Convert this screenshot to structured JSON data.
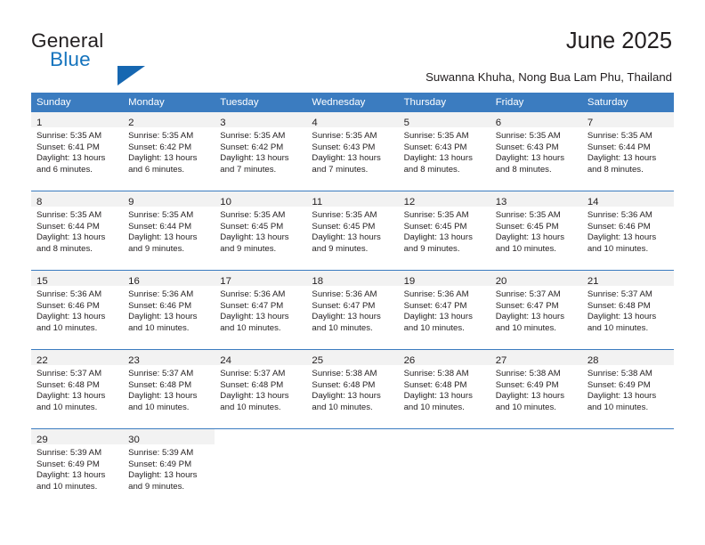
{
  "brand": {
    "name_part1": "General",
    "name_part2": "Blue",
    "accent_color": "#1473bd",
    "triangle_color": "#1667b1"
  },
  "header": {
    "title": "June 2025",
    "subtitle": "Suwanna Khuha, Nong Bua Lam Phu, Thailand"
  },
  "calendar": {
    "header_bg": "#3b7cc0",
    "daynum_bg": "#f2f2f2",
    "weekdays": [
      "Sunday",
      "Monday",
      "Tuesday",
      "Wednesday",
      "Thursday",
      "Friday",
      "Saturday"
    ],
    "weeks": [
      [
        {
          "day": "1",
          "sunrise": "Sunrise: 5:35 AM",
          "sunset": "Sunset: 6:41 PM",
          "daylight": "Daylight: 13 hours and 6 minutes."
        },
        {
          "day": "2",
          "sunrise": "Sunrise: 5:35 AM",
          "sunset": "Sunset: 6:42 PM",
          "daylight": "Daylight: 13 hours and 6 minutes."
        },
        {
          "day": "3",
          "sunrise": "Sunrise: 5:35 AM",
          "sunset": "Sunset: 6:42 PM",
          "daylight": "Daylight: 13 hours and 7 minutes."
        },
        {
          "day": "4",
          "sunrise": "Sunrise: 5:35 AM",
          "sunset": "Sunset: 6:43 PM",
          "daylight": "Daylight: 13 hours and 7 minutes."
        },
        {
          "day": "5",
          "sunrise": "Sunrise: 5:35 AM",
          "sunset": "Sunset: 6:43 PM",
          "daylight": "Daylight: 13 hours and 8 minutes."
        },
        {
          "day": "6",
          "sunrise": "Sunrise: 5:35 AM",
          "sunset": "Sunset: 6:43 PM",
          "daylight": "Daylight: 13 hours and 8 minutes."
        },
        {
          "day": "7",
          "sunrise": "Sunrise: 5:35 AM",
          "sunset": "Sunset: 6:44 PM",
          "daylight": "Daylight: 13 hours and 8 minutes."
        }
      ],
      [
        {
          "day": "8",
          "sunrise": "Sunrise: 5:35 AM",
          "sunset": "Sunset: 6:44 PM",
          "daylight": "Daylight: 13 hours and 8 minutes."
        },
        {
          "day": "9",
          "sunrise": "Sunrise: 5:35 AM",
          "sunset": "Sunset: 6:44 PM",
          "daylight": "Daylight: 13 hours and 9 minutes."
        },
        {
          "day": "10",
          "sunrise": "Sunrise: 5:35 AM",
          "sunset": "Sunset: 6:45 PM",
          "daylight": "Daylight: 13 hours and 9 minutes."
        },
        {
          "day": "11",
          "sunrise": "Sunrise: 5:35 AM",
          "sunset": "Sunset: 6:45 PM",
          "daylight": "Daylight: 13 hours and 9 minutes."
        },
        {
          "day": "12",
          "sunrise": "Sunrise: 5:35 AM",
          "sunset": "Sunset: 6:45 PM",
          "daylight": "Daylight: 13 hours and 9 minutes."
        },
        {
          "day": "13",
          "sunrise": "Sunrise: 5:35 AM",
          "sunset": "Sunset: 6:45 PM",
          "daylight": "Daylight: 13 hours and 10 minutes."
        },
        {
          "day": "14",
          "sunrise": "Sunrise: 5:36 AM",
          "sunset": "Sunset: 6:46 PM",
          "daylight": "Daylight: 13 hours and 10 minutes."
        }
      ],
      [
        {
          "day": "15",
          "sunrise": "Sunrise: 5:36 AM",
          "sunset": "Sunset: 6:46 PM",
          "daylight": "Daylight: 13 hours and 10 minutes."
        },
        {
          "day": "16",
          "sunrise": "Sunrise: 5:36 AM",
          "sunset": "Sunset: 6:46 PM",
          "daylight": "Daylight: 13 hours and 10 minutes."
        },
        {
          "day": "17",
          "sunrise": "Sunrise: 5:36 AM",
          "sunset": "Sunset: 6:47 PM",
          "daylight": "Daylight: 13 hours and 10 minutes."
        },
        {
          "day": "18",
          "sunrise": "Sunrise: 5:36 AM",
          "sunset": "Sunset: 6:47 PM",
          "daylight": "Daylight: 13 hours and 10 minutes."
        },
        {
          "day": "19",
          "sunrise": "Sunrise: 5:36 AM",
          "sunset": "Sunset: 6:47 PM",
          "daylight": "Daylight: 13 hours and 10 minutes."
        },
        {
          "day": "20",
          "sunrise": "Sunrise: 5:37 AM",
          "sunset": "Sunset: 6:47 PM",
          "daylight": "Daylight: 13 hours and 10 minutes."
        },
        {
          "day": "21",
          "sunrise": "Sunrise: 5:37 AM",
          "sunset": "Sunset: 6:48 PM",
          "daylight": "Daylight: 13 hours and 10 minutes."
        }
      ],
      [
        {
          "day": "22",
          "sunrise": "Sunrise: 5:37 AM",
          "sunset": "Sunset: 6:48 PM",
          "daylight": "Daylight: 13 hours and 10 minutes."
        },
        {
          "day": "23",
          "sunrise": "Sunrise: 5:37 AM",
          "sunset": "Sunset: 6:48 PM",
          "daylight": "Daylight: 13 hours and 10 minutes."
        },
        {
          "day": "24",
          "sunrise": "Sunrise: 5:37 AM",
          "sunset": "Sunset: 6:48 PM",
          "daylight": "Daylight: 13 hours and 10 minutes."
        },
        {
          "day": "25",
          "sunrise": "Sunrise: 5:38 AM",
          "sunset": "Sunset: 6:48 PM",
          "daylight": "Daylight: 13 hours and 10 minutes."
        },
        {
          "day": "26",
          "sunrise": "Sunrise: 5:38 AM",
          "sunset": "Sunset: 6:48 PM",
          "daylight": "Daylight: 13 hours and 10 minutes."
        },
        {
          "day": "27",
          "sunrise": "Sunrise: 5:38 AM",
          "sunset": "Sunset: 6:49 PM",
          "daylight": "Daylight: 13 hours and 10 minutes."
        },
        {
          "day": "28",
          "sunrise": "Sunrise: 5:38 AM",
          "sunset": "Sunset: 6:49 PM",
          "daylight": "Daylight: 13 hours and 10 minutes."
        }
      ],
      [
        {
          "day": "29",
          "sunrise": "Sunrise: 5:39 AM",
          "sunset": "Sunset: 6:49 PM",
          "daylight": "Daylight: 13 hours and 10 minutes."
        },
        {
          "day": "30",
          "sunrise": "Sunrise: 5:39 AM",
          "sunset": "Sunset: 6:49 PM",
          "daylight": "Daylight: 13 hours and 9 minutes."
        },
        {
          "day": "",
          "sunrise": "",
          "sunset": "",
          "daylight": ""
        },
        {
          "day": "",
          "sunrise": "",
          "sunset": "",
          "daylight": ""
        },
        {
          "day": "",
          "sunrise": "",
          "sunset": "",
          "daylight": ""
        },
        {
          "day": "",
          "sunrise": "",
          "sunset": "",
          "daylight": ""
        },
        {
          "day": "",
          "sunrise": "",
          "sunset": "",
          "daylight": ""
        }
      ]
    ]
  }
}
